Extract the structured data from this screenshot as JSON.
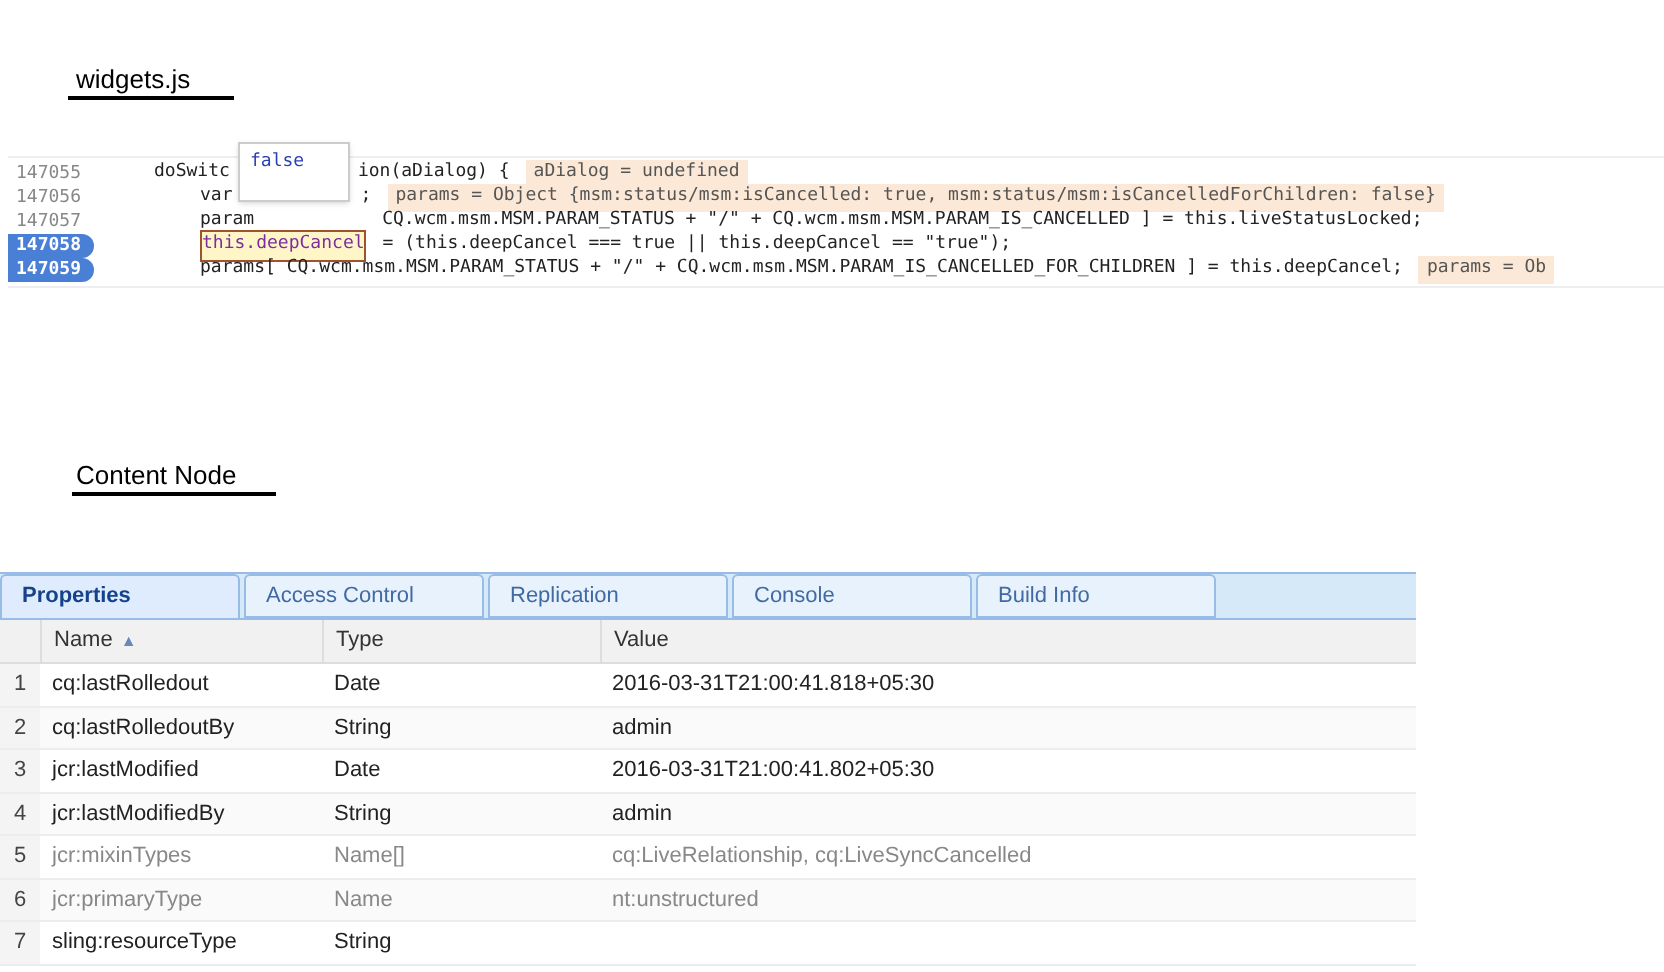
{
  "script_heading": "widgets.js",
  "code": {
    "tooltip": "false",
    "lines": [
      {
        "number": "147055",
        "breakpoint": false,
        "before_tooltip": "doSwitc",
        "segments": [
          {
            "text": "ion(aDialog) {",
            "kind": "code"
          },
          {
            "text": "aDialog = undefined",
            "kind": "value"
          }
        ],
        "children": [
          {
            "number": "147056",
            "breakpoint": false,
            "before_tooltip": "var",
            "segments": [
              {
                "text": ";",
                "kind": "code"
              },
              {
                "text": "params = Object {msm:status/msm:isCancelled: true, msm:status/msm:isCancelledForChildren: false}",
                "kind": "value"
              }
            ]
          },
          {
            "number": "147057",
            "breakpoint": false,
            "before_tooltip": "param",
            "segments": [
              {
                "text": "CQ.wcm.msm.MSM.PARAM_STATUS + \"/\" + CQ.wcm.msm.MSM.PARAM_IS_CANCELLED ] = this.liveStatusLocked;",
                "kind": "code"
              }
            ]
          },
          {
            "number": "147058",
            "breakpoint": true,
            "segments": [
              {
                "text": "this.deepCancel",
                "kind": "boxed"
              },
              {
                "text": "= (this.deepCancel === true || this.deepCancel == \"true\");",
                "kind": "code"
              }
            ]
          },
          {
            "number": "147059",
            "breakpoint": true,
            "segments": [
              {
                "text": "params[ CQ.wcm.msm.MSM.PARAM_STATUS + \"/\" + CQ.wcm.msm.MSM.PARAM_IS_CANCELLED_FOR_CHILDREN ] = this.deepCancel;",
                "kind": "code"
              },
              {
                "text": "params = Ob",
                "kind": "value"
              }
            ]
          }
        ]
      }
    ]
  },
  "node_heading": "Content Node",
  "tabs": [
    {
      "label": "Properties",
      "selected": true
    },
    {
      "label": "Access Control",
      "selected": false
    },
    {
      "label": "Replication",
      "selected": false
    },
    {
      "label": "Console",
      "selected": false
    },
    {
      "label": "Build Info",
      "selected": false
    }
  ],
  "table": {
    "columns": [
      {
        "label": "Name",
        "sort_icon": "▲"
      },
      {
        "label": "Type"
      },
      {
        "label": "Value"
      }
    ],
    "rows": [
      {
        "index": "1",
        "name": "cq:lastRolledout",
        "type": "Date",
        "value": "2016-03-31T21:00:41.818+05:30",
        "disabled": false
      },
      {
        "index": "2",
        "name": "cq:lastRolledoutBy",
        "type": "String",
        "value": "admin",
        "disabled": false
      },
      {
        "index": "3",
        "name": "jcr:lastModified",
        "type": "Date",
        "value": "2016-03-31T21:00:41.802+05:30",
        "disabled": false
      },
      {
        "index": "4",
        "name": "jcr:lastModifiedBy",
        "type": "String",
        "value": "admin",
        "disabled": false
      },
      {
        "index": "5",
        "name": "jcr:mixinTypes",
        "type": "Name[]",
        "value": "cq:LiveRelationship, cq:LiveSyncCancelled",
        "disabled": true
      },
      {
        "index": "6",
        "name": "jcr:primaryType",
        "type": "Name",
        "value": "nt:unstructured",
        "disabled": true
      },
      {
        "index": "7",
        "name": "sling:resourceType",
        "type": "String",
        "disabled": false
      }
    ]
  }
}
